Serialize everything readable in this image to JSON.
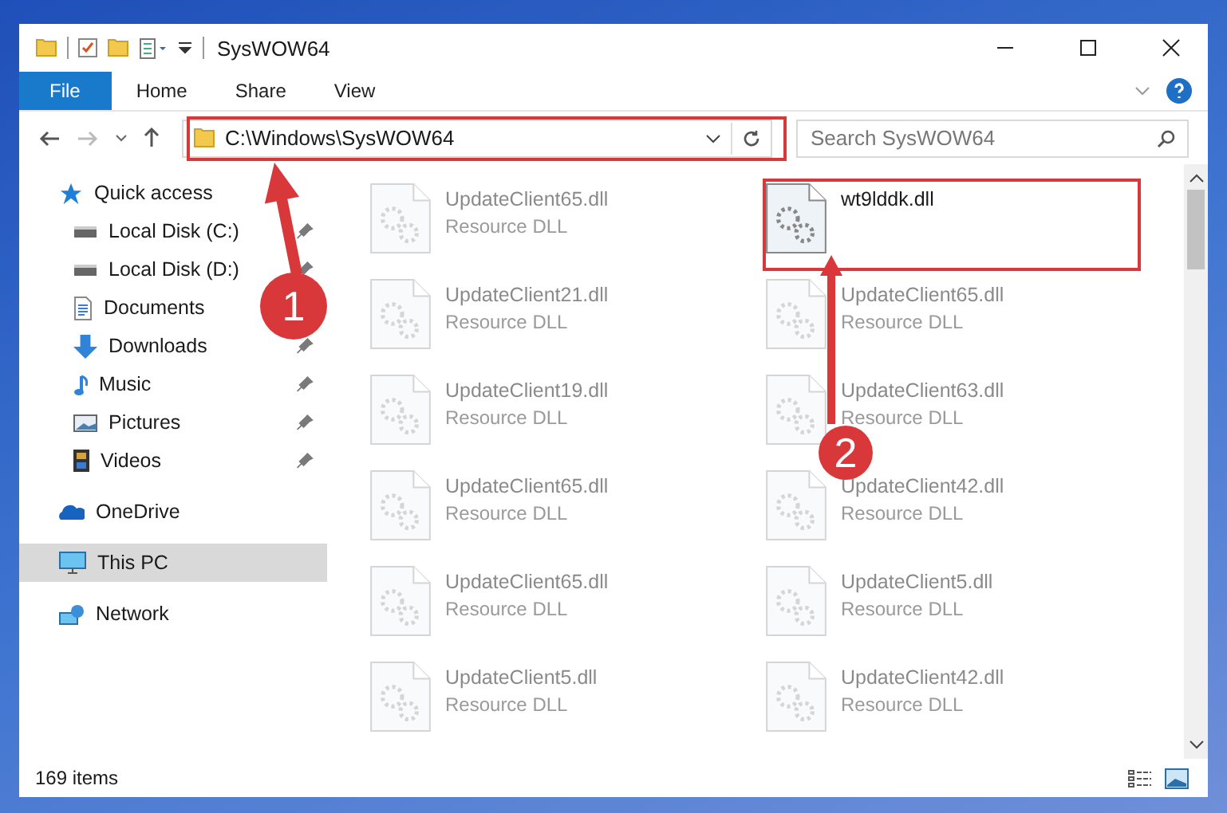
{
  "window": {
    "title": "SysWOW64"
  },
  "ribbon_tabs": [
    {
      "label": "File",
      "kind": "file"
    },
    {
      "label": "Home",
      "kind": "tab"
    },
    {
      "label": "Share",
      "kind": "tab"
    },
    {
      "label": "View",
      "kind": "tab"
    }
  ],
  "address": {
    "path": "C:\\Windows\\SysWOW64"
  },
  "search": {
    "placeholder": "Search SysWOW64"
  },
  "sidebar": [
    {
      "label": "Quick access",
      "kind": "star",
      "selected": false,
      "children": [
        {
          "label": "Local Disk (C:)",
          "kind": "disk",
          "pinned": true,
          "selected": false
        },
        {
          "label": "Local Disk (D:)",
          "kind": "disk",
          "pinned": true,
          "selected": false
        },
        {
          "label": "Documents",
          "kind": "documents",
          "selected": false
        },
        {
          "label": "Downloads",
          "kind": "download",
          "pinned": true,
          "selected": false
        },
        {
          "label": "Music",
          "kind": "music",
          "pinned": true,
          "selected": false
        },
        {
          "label": "Pictures",
          "kind": "pictures",
          "pinned": true,
          "selected": false
        },
        {
          "label": "Videos",
          "kind": "videos",
          "pinned": true,
          "selected": false
        }
      ]
    },
    {
      "label": "OneDrive",
      "kind": "cloud",
      "selected": false
    },
    {
      "label": "This PC",
      "kind": "pc",
      "selected": true
    },
    {
      "label": "Network",
      "kind": "network",
      "selected": false
    }
  ],
  "files": [
    {
      "name": "UpdateClient65.dll",
      "type": "Resource DLL",
      "faded": true
    },
    {
      "name": "wt9lddk.dll",
      "faded": false
    },
    {
      "name": "UpdateClient21.dll",
      "type": "Resource DLL",
      "faded": true
    },
    {
      "name": "UpdateClient65.dll",
      "type": "Resource DLL",
      "faded": true
    },
    {
      "name": "UpdateClient19.dll",
      "type": "Resource DLL",
      "faded": true
    },
    {
      "name": "UpdateClient63.dll",
      "type": "Resource DLL",
      "faded": true
    },
    {
      "name": "UpdateClient65.dll",
      "type": "Resource DLL",
      "faded": true
    },
    {
      "name": "UpdateClient42.dll",
      "type": "Resource DLL",
      "faded": true
    },
    {
      "name": "UpdateClient65.dll",
      "type": "Resource DLL",
      "faded": true
    },
    {
      "name": "UpdateClient5.dll",
      "type": "Resource DLL",
      "faded": true
    },
    {
      "name": "UpdateClient5.dll",
      "type": "Resource DLL",
      "faded": true
    },
    {
      "name": "UpdateClient42.dll",
      "type": "Resource DLL",
      "faded": true
    }
  ],
  "annotations": [
    {
      "number": "1"
    },
    {
      "number": "2"
    }
  ],
  "status_bar": {
    "item_count": "169 items"
  }
}
